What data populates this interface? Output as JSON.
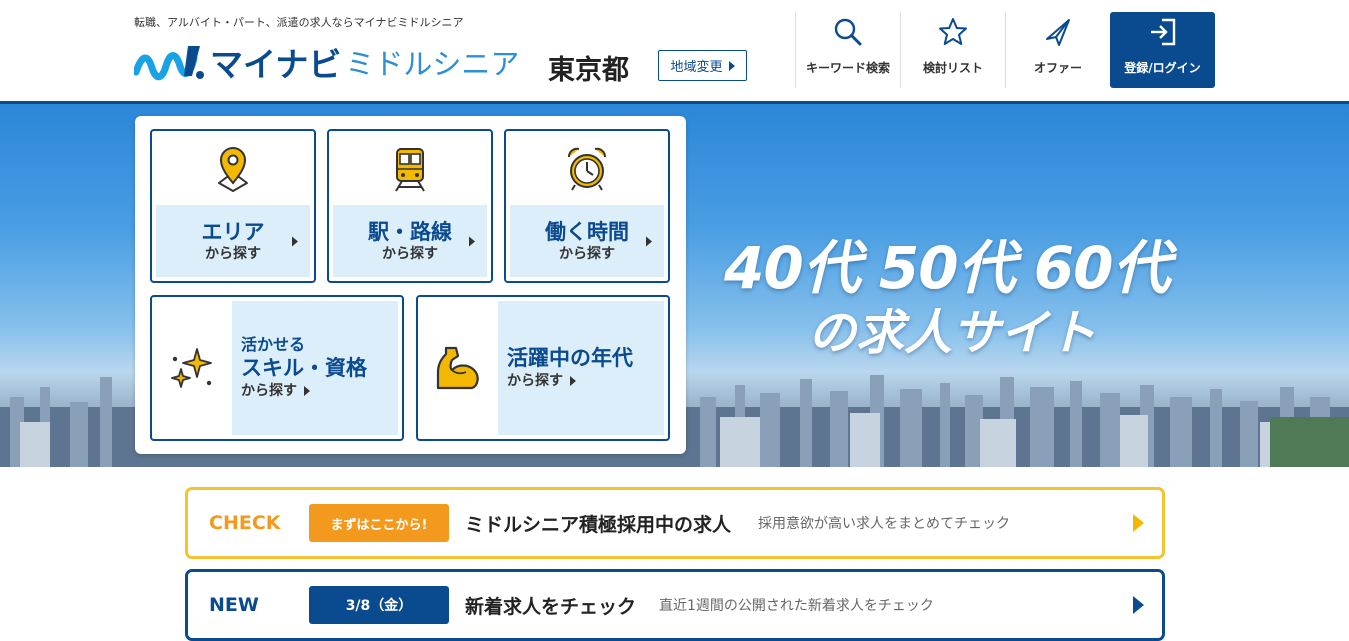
{
  "header": {
    "tagline": "転職、アルバイト・パート、派遣の求人ならマイナビミドルシニア",
    "logo_main": "マイナビ",
    "logo_sub": "ミドルシニア",
    "prefecture": "東京都",
    "region_change": "地域変更",
    "nav": {
      "keyword_search": "キーワード検索",
      "favorites": "検討リスト",
      "offer": "オファー",
      "login": "登録/ログイン"
    }
  },
  "hero": {
    "copy_line1": "40代 50代 60代",
    "copy_line2": "の求人サイト"
  },
  "search_cards": [
    {
      "main": "エリア",
      "sub": "から探す",
      "icon": "map-pin-icon"
    },
    {
      "main": "駅・路線",
      "sub": "から探す",
      "icon": "train-icon"
    },
    {
      "main": "働く時間",
      "sub": "から探す",
      "icon": "alarm-clock-icon"
    },
    {
      "line1": "活かせる",
      "line2": "スキル・資格",
      "sub": "から探す",
      "icon": "sparkle-icon"
    },
    {
      "main": "活躍中の年代",
      "sub": "から探す",
      "icon": "flexed-arm-icon"
    }
  ],
  "banners": {
    "check": {
      "tag": "CHECK",
      "pill": "まずはここから!",
      "title": "ミドルシニア積極採用中の求人",
      "desc": "採用意欲が高い求人をまとめてチェック"
    },
    "new": {
      "tag": "NEW",
      "pill": "3/8（金）",
      "title": "新着求人をチェック",
      "desc": "直近1週間の公開された新着求人をチェック"
    }
  },
  "colors": {
    "brand_navy": "#0a4a8f",
    "brand_light_blue": "#2e8fd6",
    "check_orange": "#f39a1e",
    "check_border": "#f5c332",
    "card_fill": "#dceefa",
    "icon_yellow": "#f5b800"
  }
}
